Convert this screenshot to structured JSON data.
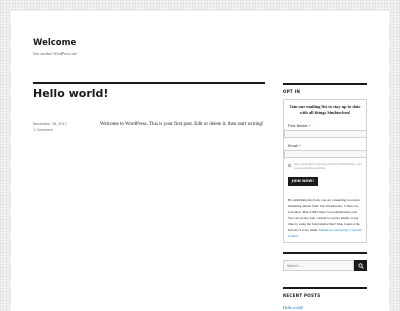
{
  "site": {
    "title": "Welcome",
    "description": "Just another WordPress site"
  },
  "post": {
    "title": "Hello world!",
    "date": "November 28, 2017",
    "comments": "1 Comment",
    "content": "Welcome to WordPress. This is your first post. Edit or delete it, then start writing!"
  },
  "optin_widget": {
    "title": "OPT IN",
    "heading": "Join our mailing list to stay up to date with all things Simbiechen!",
    "first_name_label": "First Name",
    "email_label": "Email",
    "required_mark": "*",
    "consent_text": "Yes, I would like to receive emails from Simbiechen. (You can unsubscribe anytime)",
    "button_label": "JOIN NOW!",
    "fine_print": "By submitting this form, you are consenting to receive marketing emails from: The Wonders Inc, 2 Vireo Ln, Lawrence, MA, 01843, http://www.simbiechen.com. You can revoke your consent to receive emails at any time by using the SafeUnsubscribe® link, found at the bottom of every email.",
    "fine_print_link": "Emails are serviced by Constant Contact"
  },
  "search_widget": {
    "title": "SEARCH",
    "placeholder": "Search …",
    "icon": "search-icon"
  },
  "recent_posts_widget": {
    "title": "RECENT POSTS",
    "items": [
      "Hello world!"
    ]
  },
  "colors": {
    "text": "#1a1a1a",
    "meta": "#686868",
    "link": "#007acc",
    "background": "#f3f3f3"
  }
}
